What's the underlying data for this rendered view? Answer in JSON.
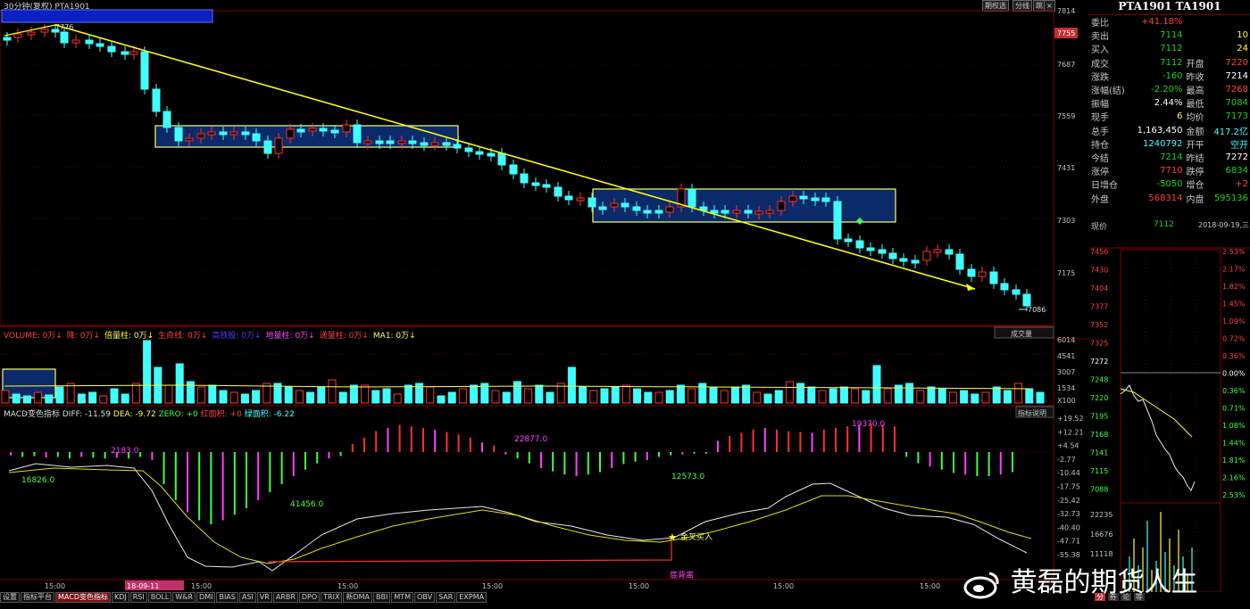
{
  "chart_header": {
    "period_label": "30分钟(复权)",
    "contract_code": "PTA1901",
    "btn_mid": "跳",
    "btn_switch": "期权选",
    "btn_table": "分线",
    "btn_close": "×"
  },
  "price_axis": {
    "labels": [
      "7814",
      "7755",
      "7687",
      "7559",
      "7431",
      "7303",
      "7175"
    ],
    "current_tag": "7755"
  },
  "price_panel": {
    "high_label": "7776",
    "low_label": "7086"
  },
  "volume_panel": {
    "legend": [
      {
        "text": "VOLUME: 0万",
        "color": "#ff4040"
      },
      {
        "text": "降: 0万",
        "color": "#ff4040"
      },
      {
        "text": "倍量柱: 0万",
        "color": "#ffff40"
      },
      {
        "text": "生命线: 0万",
        "color": "#ff4040"
      },
      {
        "text": "高铁股: 0万",
        "color": "#4040ff"
      },
      {
        "text": "地量柱: 0万",
        "color": "#ff40ff"
      },
      {
        "text": "递量柱: 0万",
        "color": "#ff4040"
      },
      {
        "text": "MA1: 0万",
        "color": "#ffff40"
      }
    ],
    "button": "成交量",
    "axis_labels": [
      "6014",
      "4541",
      "3007",
      "1534",
      "X100"
    ]
  },
  "macd_panel": {
    "title": "MACD变色指标",
    "diff": "DIFF: -11.59",
    "dea": "DEA: -9.72",
    "zero": "ZERO: +0",
    "red_area": "红面积: +0",
    "green_area": "绿面积: -6.22",
    "button": "指标说明",
    "axis_labels": [
      "+19.52",
      "+12.21",
      "+4.54",
      "-2.77",
      "-10.44",
      "-17.75",
      "-25.42",
      "-32.73",
      "-40.40",
      "-47.71",
      "-55.38"
    ],
    "annotations": {
      "a1": "16826.0",
      "a2": "2183.0",
      "a3": "41456.0",
      "a4": "22877.0",
      "a5": "12573.0",
      "a6": "19370.0"
    },
    "golden_cross": "金叉买入",
    "divergence": "底背离"
  },
  "time_axis": {
    "labels": [
      "15:00",
      "15:00",
      "15:00",
      "15:00",
      "15:00",
      "15:00",
      "15:00"
    ],
    "date_tag": "18-09-11"
  },
  "quote": {
    "title": "PTA1901  TA1901",
    "rows": [
      {
        "l": "委比",
        "v": "+41.18%",
        "c": "red",
        "l2": "",
        "v2": "",
        "c2": ""
      },
      {
        "l": "卖出",
        "v": "7114",
        "c": "grn",
        "l2": "",
        "v2": "10",
        "c2": "yel"
      },
      {
        "l": "买入",
        "v": "7112",
        "c": "grn",
        "l2": "",
        "v2": "24",
        "c2": "yel"
      },
      {
        "l": "成交",
        "v": "7112",
        "c": "grn",
        "l2": "开盘",
        "v2": "7220",
        "c2": "red"
      },
      {
        "l": "涨跌",
        "v": "-160",
        "c": "grn",
        "l2": "昨收",
        "v2": "7214",
        "c2": "wht"
      },
      {
        "l": "涨幅(结)",
        "v": "-2.20%",
        "c": "grn",
        "l2": "最高",
        "v2": "7268",
        "c2": "red"
      },
      {
        "l": "振幅",
        "v": "2.44%",
        "c": "wht",
        "l2": "最低",
        "v2": "7084",
        "c2": "grn"
      },
      {
        "l": "现手",
        "v": "6",
        "c": "yel",
        "l2": "均价",
        "v2": "7173",
        "c2": "grn"
      },
      {
        "l": "总手",
        "v": "1,163,450",
        "c": "wht",
        "l2": "金额",
        "v2": "417.2亿",
        "c2": "cyn"
      },
      {
        "l": "持仓",
        "v": "1240792",
        "c": "cyn",
        "l2": "开平",
        "v2": "空开",
        "c2": "cyn"
      },
      {
        "l": "今结",
        "v": "7214",
        "c": "grn",
        "l2": "昨结",
        "v2": "7272",
        "c2": "wht"
      },
      {
        "l": "涨停",
        "v": "7710",
        "c": "red",
        "l2": "跌停",
        "v2": "6834",
        "c2": "grn"
      },
      {
        "l": "日增仓",
        "v": "-5050",
        "c": "grn",
        "l2": "增仓",
        "v2": "+2",
        "c2": "red"
      },
      {
        "l": "外盘",
        "v": "568314",
        "c": "red",
        "l2": "内盘",
        "v2": "595136",
        "c2": "grn"
      }
    ]
  },
  "minute_chart": {
    "price_label": "现价",
    "price_value": "7112",
    "date": "2018-09-19,三",
    "left_axis": [
      "7456",
      "7430",
      "7404",
      "7377",
      "7352",
      "7325",
      "7272",
      "7248",
      "7220",
      "7195",
      "7168",
      "7141",
      "7115",
      "7088"
    ],
    "right_axis": [
      "2.53%",
      "2.17%",
      "1.82%",
      "1.45%",
      "1.09%",
      "0.72%",
      "0.36%",
      "0.00%",
      "0.36%",
      "0.71%",
      "1.08%",
      "1.44%",
      "1.81%",
      "2.16%",
      "2.53%"
    ],
    "vol_axis": [
      "22235",
      "16676",
      "11118"
    ]
  },
  "bottom_tabs": [
    "设置",
    "指标平台",
    "MACD变色指标",
    "KDJ",
    "RSI",
    "BOLL",
    "W&R",
    "DMI",
    "BIAS",
    "ASI",
    "VR",
    "ARBR",
    "DPO",
    "TRIX",
    "新DMA",
    "BBI",
    "MTM",
    "OBV",
    "SAR",
    "EXPMA"
  ],
  "active_tab": "MACD变色指标",
  "bottom_icons": {
    "f1": "分",
    "f2": "券",
    "f3": "论",
    "f4": "等"
  },
  "watermark": "黄磊的期货人生",
  "colors": {
    "up": "#ff3030",
    "down": "#40ffff",
    "trend": "#ffff00",
    "box": "#ffff60",
    "box_fill": "#0a2a6a"
  }
}
